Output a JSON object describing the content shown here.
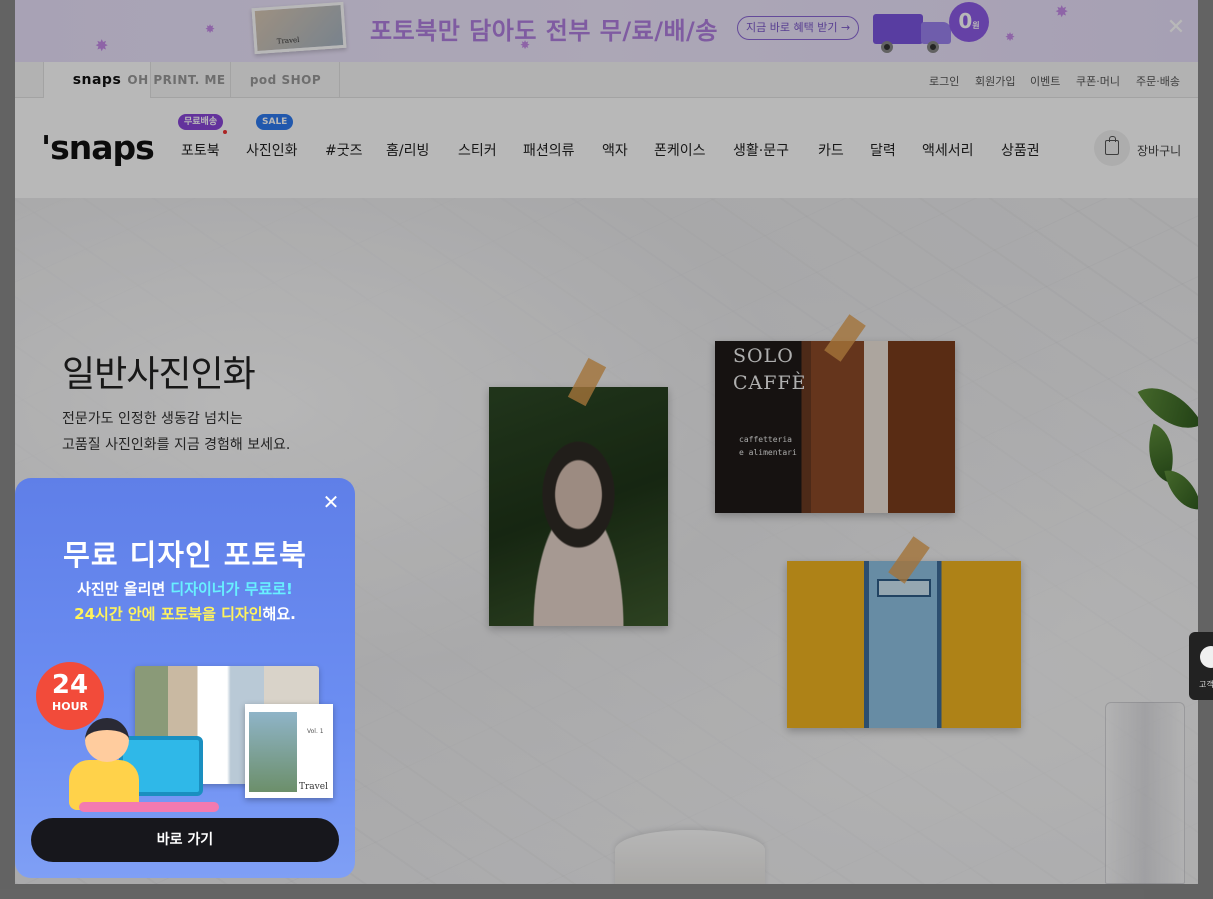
{
  "promo": {
    "thumb_label": "Travel",
    "title": "포토북만 담아도 전부 무/료/배/송",
    "button_label": "지금 바로 혜택 받기 →",
    "badge_value": "0",
    "badge_unit": "원",
    "close_label": "✕"
  },
  "sites": {
    "tabs": [
      {
        "label": "snaps"
      },
      {
        "label": "OH PRINT. ME"
      },
      {
        "label": "pod SHOP"
      }
    ]
  },
  "util": {
    "links": [
      {
        "label": "로그인"
      },
      {
        "label": "회원가입"
      },
      {
        "label": "이벤트"
      },
      {
        "label": "쿠폰·머니"
      },
      {
        "label": "주문·배송"
      }
    ]
  },
  "nav": {
    "logo": "'snaps",
    "items": [
      {
        "label": "포토북",
        "badge": "무료배송"
      },
      {
        "label": "사진인화",
        "badge": "SALE"
      },
      {
        "label": "#굿즈"
      },
      {
        "label": "홈/리빙"
      },
      {
        "label": "스티커"
      },
      {
        "label": "패션의류"
      },
      {
        "label": "액자"
      },
      {
        "label": "폰케이스"
      },
      {
        "label": "생활·문구"
      },
      {
        "label": "카드"
      },
      {
        "label": "달력"
      },
      {
        "label": "액세서리"
      },
      {
        "label": "상품권"
      }
    ],
    "cart_label": "장바구니"
  },
  "hero": {
    "title": "일반사진인화",
    "desc_line1": "전문가도 인정한 생동감 넘치는",
    "desc_line2": "고품질 사진인화를 지금 경험해 보세요.",
    "photo2_sign": "SOLO\nCAFFÈ",
    "photo2_sub": "caffetteria\ne alimentari"
  },
  "side_widget": {
    "label": "고객"
  },
  "popup": {
    "close_label": "✕",
    "title": "무료 디자인 포토북",
    "line1_pre": "사진만 올리면 ",
    "line1_hl": "디자이너가 무료로!",
    "line2_hl": "24시간 안에 포토북을 디자인",
    "line2_post": "해요.",
    "badge_num": "24",
    "badge_unit": "HOUR",
    "book_vol": "Vol. 1",
    "book_title": "Travel",
    "button_label": "바로 가기"
  },
  "colors": {
    "accent_purple": "#8a46d9",
    "sale_blue": "#2f7bf0",
    "popup_blue": "#6c8ef2",
    "highlight_yellow": "#fff45c"
  }
}
